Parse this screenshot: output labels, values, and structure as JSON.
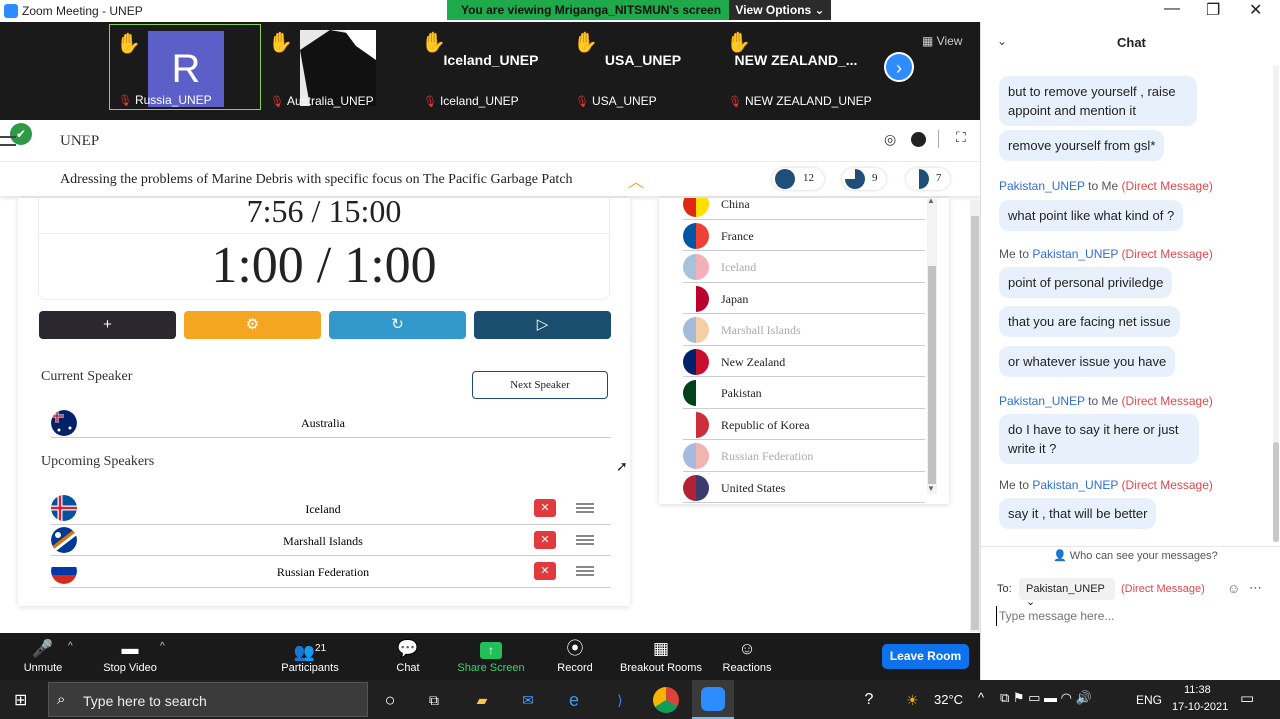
{
  "window": {
    "title": "Zoom Meeting - UNEP",
    "minimize": "—",
    "maximize": "❐",
    "close": "✕"
  },
  "share_banner": {
    "message": "You are viewing Mriganga_NITSMUN's screen",
    "view_options": "View Options ⌄"
  },
  "participants_strip": {
    "tiles": [
      {
        "name": "Russia_UNEP",
        "avatar_letter": "R",
        "avatar_color": "#5b5fc7"
      },
      {
        "name": "Australia_UNEP"
      },
      {
        "name": "Iceland_UNEP",
        "display": "Iceland_UNEP"
      },
      {
        "name": "USA_UNEP",
        "display": "USA_UNEP"
      },
      {
        "name": "NEW ZEALAND_UNEP",
        "display": "NEW  ZEALAND_..."
      }
    ],
    "view_label": "View"
  },
  "shared_screen": {
    "header": {
      "title": "UNEP"
    },
    "agenda": {
      "text": "Adressing the problems of Marine Debris with specific focus on The Pacific Garbage Patch",
      "stats": [
        {
          "value": "12"
        },
        {
          "value": "9"
        },
        {
          "value": "7"
        }
      ]
    },
    "timer": {
      "total": "7:56 / 15:00",
      "speaker": "1:00 / 1:00"
    },
    "controls": {
      "add": "+",
      "settings_icon": "gear",
      "reset_icon": "refresh",
      "play_icon": "play"
    },
    "current_speaker": {
      "heading": "Current Speaker",
      "next_button": "Next Speaker",
      "name": "Australia"
    },
    "upcoming": {
      "heading": "Upcoming Speakers",
      "speakers": [
        "Iceland",
        "Marshall Islands",
        "Russian Federation"
      ],
      "remove": "✕"
    },
    "country_list": [
      {
        "name": "China",
        "dim": false
      },
      {
        "name": "France",
        "dim": false
      },
      {
        "name": "Iceland",
        "dim": true
      },
      {
        "name": "Japan",
        "dim": false
      },
      {
        "name": "Marshall Islands",
        "dim": true
      },
      {
        "name": "New Zealand",
        "dim": false
      },
      {
        "name": "Pakistan",
        "dim": false
      },
      {
        "name": "Republic of Korea",
        "dim": false
      },
      {
        "name": "Russian Federation",
        "dim": true
      },
      {
        "name": "United States",
        "dim": false
      }
    ]
  },
  "chat": {
    "title": "Chat",
    "messages": [
      {
        "text": "but to remove yourself , raise appoint and mention it"
      },
      {
        "text": "remove yourself from gsl*"
      },
      {
        "meta": {
          "from": "Pakistan_UNEP",
          "to": " to Me",
          "tag": "(Direct Message)"
        },
        "text": "what point like what kind of ?"
      },
      {
        "meta": {
          "from": "Me",
          "to": " to ",
          "who": "Pakistan_UNEP",
          "tag": "(Direct Message)"
        },
        "text": "point of personal priviledge"
      },
      {
        "text": "that you are facing net issue"
      },
      {
        "text": "or whatever issue you have"
      },
      {
        "meta": {
          "from": "Pakistan_UNEP",
          "to": " to Me",
          "tag": "(Direct Message)"
        },
        "text": "do I have to say it here or just write it ?"
      },
      {
        "meta": {
          "from": "Me",
          "to": " to ",
          "who": "Pakistan_UNEP",
          "tag": "(Direct Message)"
        },
        "text": "say it , that will be better"
      }
    ],
    "privacy": "Who can see your messages?",
    "to_label": "To:",
    "recipient": "Pakistan_UNEP",
    "recipient_tag": "(Direct Message)",
    "input_placeholder": "Type message here..."
  },
  "toolbar": {
    "unmute": "Unmute",
    "stop_video": "Stop Video",
    "participants": "Participants",
    "participants_count": "21",
    "chat": "Chat",
    "share_screen": "Share Screen",
    "record": "Record",
    "breakout_rooms": "Breakout Rooms",
    "reactions": "Reactions",
    "leave_room": "Leave Room"
  },
  "taskbar": {
    "search_placeholder": "Type here to search",
    "weather": "32°C",
    "language": "ENG",
    "time": "11:38",
    "date": "17-10-2021"
  }
}
